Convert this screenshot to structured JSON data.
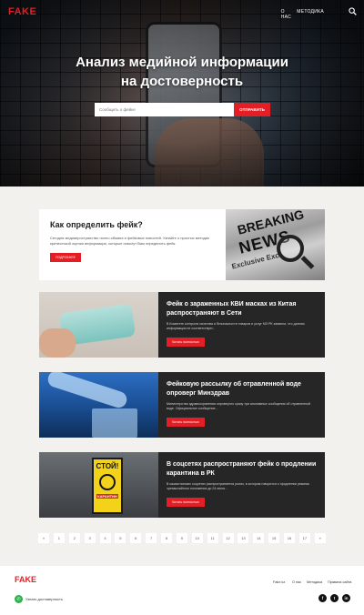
{
  "header": {
    "logo": "FAKE",
    "nav": [
      "О НАС",
      "МЕТОДИКА"
    ]
  },
  "hero": {
    "title_line1": "Анализ медийной информации",
    "title_line2": "на достоверность",
    "report_placeholder": "Сообщить о фейке",
    "report_button": "ОТПРАВИТЬ"
  },
  "intro": {
    "title": "Как определить фейк?",
    "text": "Сегодня медиапространство полно обмана и фейковых новостей. Узнайте о простых методах критической оценки информации, которые помогут Вам определить фейк.",
    "button": "ПОДРОБНЕЕ",
    "image_words": [
      "BREAKING",
      "NEWS",
      "Exclusive Excl"
    ]
  },
  "news": [
    {
      "title": "Фейк о зараженных КВИ масках из Китая распространяют в Сети",
      "text": "В Комитете контроля качества и безопасности товаров и услуг МЗ РК заявили, что данная информация не соответствует...",
      "button": "Читать полностью"
    },
    {
      "title": "Фейковую рассылку об отравленной воде опроверг Минздрав",
      "text": "Министерство здравоохранения опровергло сразу три аноним­ных сообщения об отравленной воде. Официальное сообщение...",
      "button": "Читать полностью"
    },
    {
      "title": "В соцсетях распространяют фейк о продлении карантина в РК",
      "text": "В казахстанских соцсетях распространяется ролик, в котором говорится о продлении режима чрезвычайного положения до 24 июля...",
      "button": "Читать полностью",
      "sign_text": [
        "СТОЙ!",
        "КАРАНТИН"
      ]
    }
  ],
  "pagination": [
    "«",
    "1",
    "2",
    "3",
    "4",
    "5",
    "6",
    "7",
    "8",
    "9",
    "10",
    "11",
    "12",
    "13",
    "14",
    "15",
    "16",
    "17",
    "»"
  ],
  "footer": {
    "logo": "FAKE",
    "links": [
      "Fake.kz",
      "О нас",
      "Методика",
      "Правила сайта"
    ],
    "report_label": "Узнать достоверность",
    "social": [
      "f",
      "t",
      "in"
    ]
  },
  "colors": {
    "accent": "#e31e24",
    "dark_card": "#262626",
    "page_bg": "#f2f1ee"
  }
}
